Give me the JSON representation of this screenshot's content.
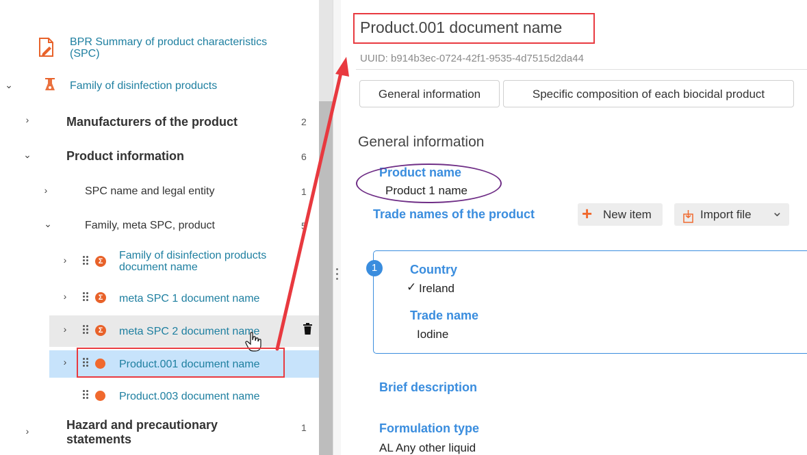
{
  "tree": {
    "spc_root_label": "BPR Summary of product characteristics (SPC)",
    "family_label": "Family of disinfection products",
    "items": {
      "manufacturers": {
        "label": "Manufacturers of the product",
        "count": "2"
      },
      "product_information": {
        "label": "Product information",
        "count": "6"
      },
      "spc_name": {
        "label": "SPC name and legal entity",
        "count": "1"
      },
      "family_meta": {
        "label": "Family, meta SPC, product",
        "count": "5"
      },
      "family_doc": {
        "label": "Family of disinfection products document name"
      },
      "meta1": {
        "label": "meta SPC 1 document name"
      },
      "meta2": {
        "label": "meta SPC 2 document name"
      },
      "product001": {
        "label": "Product.001 document name"
      },
      "product003": {
        "label": "Product.003 document name"
      },
      "hazard": {
        "label": "Hazard and precautionary statements",
        "count": "1"
      }
    },
    "icons": {
      "collapsed": "›",
      "expanded": "⌄",
      "sigma": "Σ",
      "trash": "trash-icon"
    }
  },
  "detail": {
    "title": "Product.001 document name",
    "uuid": "UUID: b914b3ec-0724-42f1-9535-4d7515d2da44",
    "tabs": [
      "General information",
      "Specific composition of each biocidal product"
    ],
    "section_heading": "General information",
    "product_name_label": "Product name",
    "product_name_value": "Product 1 name",
    "trade_names_label": "Trade names of the product",
    "new_item_label": "New item",
    "import_file_label": "Import file",
    "item_number": "1",
    "country_label": "Country",
    "country_value": "Ireland",
    "trade_name_label": "Trade name",
    "trade_name_value": "Iodine",
    "brief_description_label": "Brief description",
    "formulation_type_label": "Formulation type",
    "formulation_type_value": "AL Any other liquid"
  },
  "colors": {
    "link_blue": "#1e7fa0",
    "field_blue": "#3a8dde",
    "selected_row": "#c7e3fb",
    "hover_row": "#e9e9e9",
    "accent_orange": "#f0692e",
    "annotation_red": "#e8393f",
    "annotation_purple": "#6f2e86"
  }
}
